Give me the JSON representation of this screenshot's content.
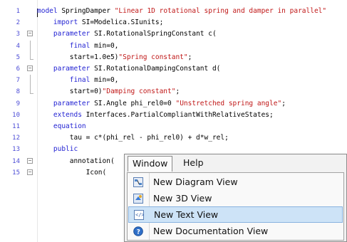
{
  "editor": {
    "lines": [
      {
        "num": "1",
        "segments": [
          {
            "t": "model",
            "c": "kw"
          },
          {
            "t": " SpringDamper ",
            "c": ""
          },
          {
            "t": "\"Linear 1D rotational spring and damper in parallel\"",
            "c": "str"
          }
        ]
      },
      {
        "num": "2",
        "segments": [
          {
            "t": "    import",
            "c": "kw"
          },
          {
            "t": " SI=Modelica.SIunits;",
            "c": ""
          }
        ]
      },
      {
        "num": "3",
        "segments": [
          {
            "t": "    parameter",
            "c": "kw"
          },
          {
            "t": " SI.RotationalSpringConstant c(",
            "c": ""
          }
        ]
      },
      {
        "num": "4",
        "segments": [
          {
            "t": "        final",
            "c": "kw"
          },
          {
            "t": " min=0,",
            "c": ""
          }
        ]
      },
      {
        "num": "5",
        "segments": [
          {
            "t": "        start=1.0e5)",
            "c": ""
          },
          {
            "t": "\"Spring constant\"",
            "c": "str"
          },
          {
            "t": ";",
            "c": ""
          }
        ]
      },
      {
        "num": "6",
        "segments": [
          {
            "t": "    parameter",
            "c": "kw"
          },
          {
            "t": " SI.RotationalDampingConstant d(",
            "c": ""
          }
        ]
      },
      {
        "num": "7",
        "segments": [
          {
            "t": "        final",
            "c": "kw"
          },
          {
            "t": " min=0,",
            "c": ""
          }
        ]
      },
      {
        "num": "8",
        "segments": [
          {
            "t": "        start=0)",
            "c": ""
          },
          {
            "t": "\"Damping constant\"",
            "c": "str"
          },
          {
            "t": ";",
            "c": ""
          }
        ]
      },
      {
        "num": "9",
        "segments": [
          {
            "t": "    parameter",
            "c": "kw"
          },
          {
            "t": " SI.Angle phi_rel0=0 ",
            "c": ""
          },
          {
            "t": "\"Unstretched spring angle\"",
            "c": "str"
          },
          {
            "t": ";",
            "c": ""
          }
        ]
      },
      {
        "num": "10",
        "segments": [
          {
            "t": "    extends",
            "c": "kw"
          },
          {
            "t": " Interfaces.PartialCompliantWithRelativeStates;",
            "c": ""
          }
        ]
      },
      {
        "num": "11",
        "segments": [
          {
            "t": "    equation",
            "c": "kw"
          }
        ]
      },
      {
        "num": "12",
        "segments": [
          {
            "t": "        tau = c*(phi_rel - phi_rel0) + d*w_rel;",
            "c": ""
          }
        ]
      },
      {
        "num": "13",
        "segments": [
          {
            "t": "    public",
            "c": "kw"
          }
        ]
      },
      {
        "num": "14",
        "segments": [
          {
            "t": "        annotation(",
            "c": ""
          }
        ]
      },
      {
        "num": "15",
        "segments": [
          {
            "t": "            Icon(",
            "c": ""
          }
        ]
      }
    ]
  },
  "menu": {
    "top_items": [
      "Window",
      "Help"
    ],
    "active_top": "Window",
    "items": [
      {
        "label": "New Diagram View",
        "icon": "diagram-view-icon",
        "highlighted": false
      },
      {
        "label": "New 3D View",
        "icon": "3d-view-icon",
        "highlighted": false
      },
      {
        "label": "New Text View",
        "icon": "text-view-icon",
        "highlighted": true
      },
      {
        "label": "New Documentation View",
        "icon": "documentation-view-icon",
        "highlighted": false
      }
    ]
  },
  "colors": {
    "keyword": "#1f1fd2",
    "string": "#c01717",
    "line_number": "#4d4dd6",
    "highlight": "#cde3f7"
  }
}
